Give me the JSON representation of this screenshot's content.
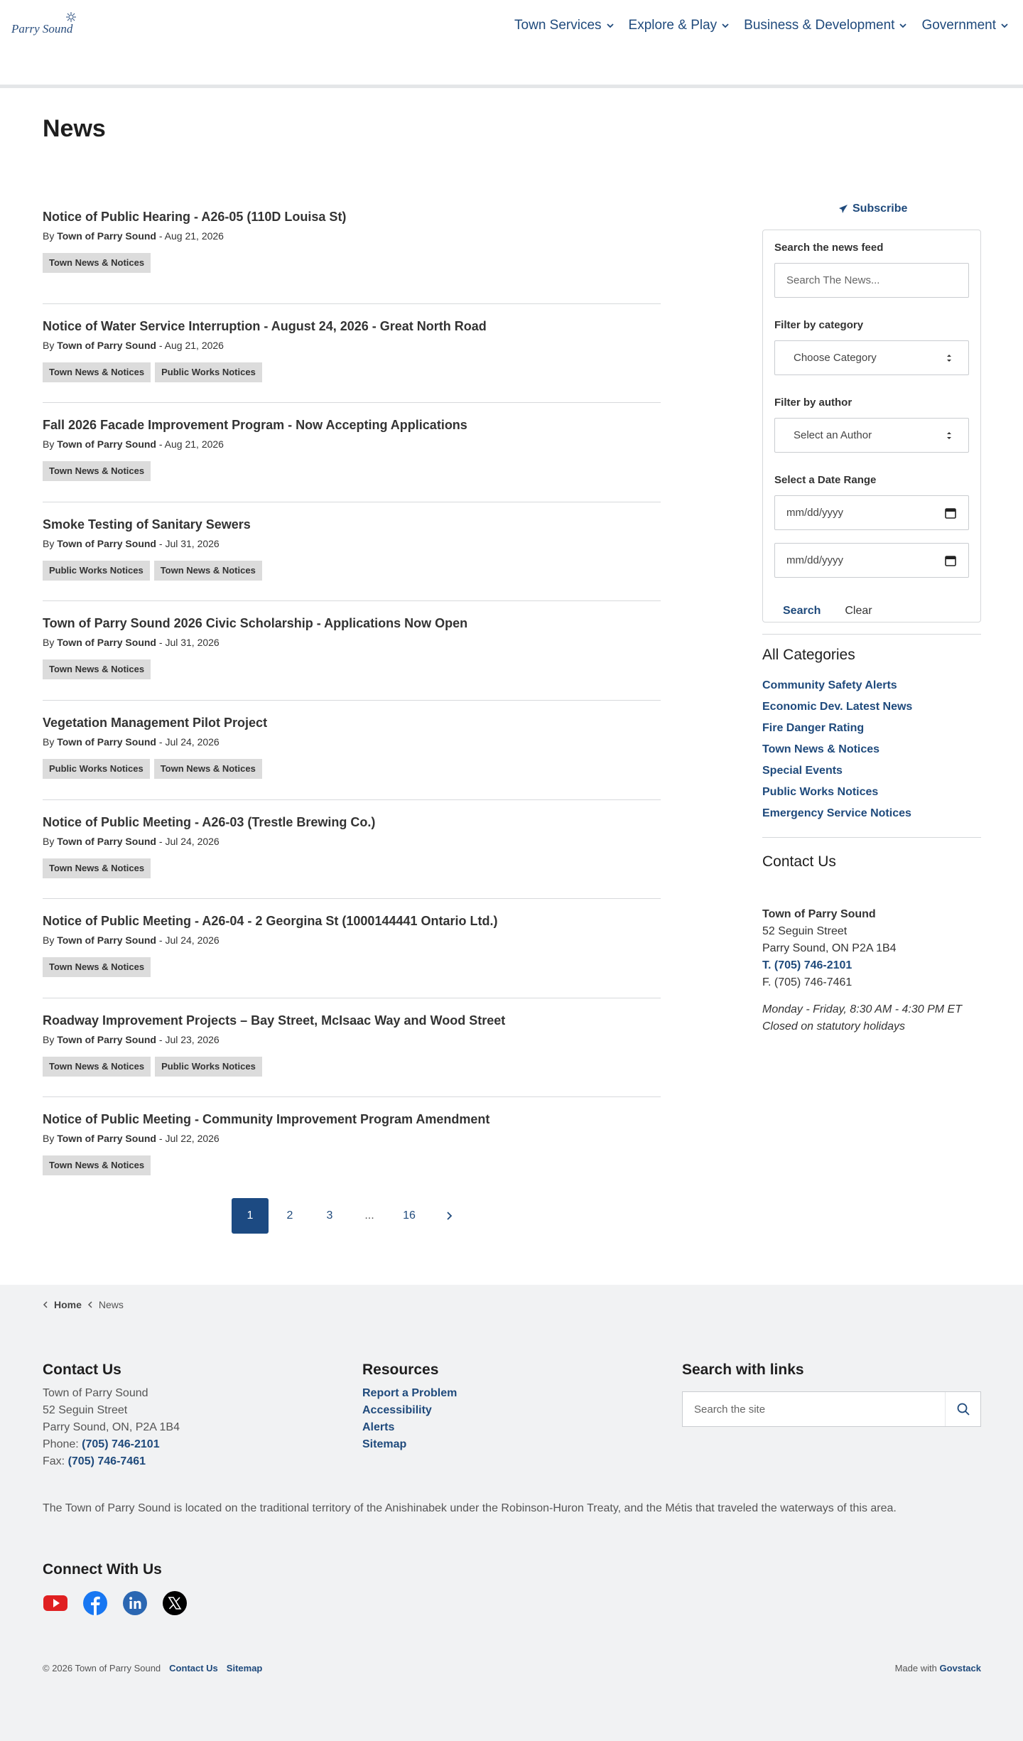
{
  "header": {
    "logo_text": "Parry Sound",
    "nav": [
      {
        "label": "Town Services"
      },
      {
        "label": "Explore & Play"
      },
      {
        "label": "Business & Development"
      },
      {
        "label": "Government"
      }
    ]
  },
  "page": {
    "title": "News"
  },
  "news": [
    {
      "title": "Notice of Public Hearing - A26-05 (110D Louisa St)",
      "by": "By",
      "author": "Town of Parry Sound",
      "sep": "-",
      "date": "Aug 21, 2026",
      "tags": [
        "Town News & Notices"
      ]
    },
    {
      "title": "Notice of Water Service Interruption - August 24, 2026 - Great North Road",
      "by": "By",
      "author": "Town of Parry Sound",
      "sep": "-",
      "date": "Aug 21, 2026",
      "tags": [
        "Town News & Notices",
        "Public Works Notices"
      ]
    },
    {
      "title": "Fall 2026 Facade Improvement Program - Now Accepting Applications",
      "by": "By",
      "author": "Town of Parry Sound",
      "sep": "-",
      "date": "Aug 21, 2026",
      "tags": [
        "Town News & Notices"
      ]
    },
    {
      "title": "Smoke Testing of Sanitary Sewers",
      "by": "By",
      "author": "Town of Parry Sound",
      "sep": "-",
      "date": "Jul 31, 2026",
      "tags": [
        "Public Works Notices",
        "Town News & Notices"
      ]
    },
    {
      "title": "Town of Parry Sound 2026 Civic Scholarship - Applications Now Open",
      "by": "By",
      "author": "Town of Parry Sound",
      "sep": "-",
      "date": "Jul 31, 2026",
      "tags": [
        "Town News & Notices"
      ]
    },
    {
      "title": "Vegetation Management Pilot Project",
      "by": "By",
      "author": "Town of Parry Sound",
      "sep": "-",
      "date": "Jul 24, 2026",
      "tags": [
        "Public Works Notices",
        "Town News & Notices"
      ]
    },
    {
      "title": "Notice of Public Meeting - A26-03 (Trestle Brewing Co.)",
      "by": "By",
      "author": "Town of Parry Sound",
      "sep": "-",
      "date": "Jul 24, 2026",
      "tags": [
        "Town News & Notices"
      ]
    },
    {
      "title": "Notice of Public Meeting - A26-04 - 2 Georgina St (1000144441 Ontario Ltd.)",
      "by": "By",
      "author": "Town of Parry Sound",
      "sep": "-",
      "date": "Jul 24, 2026",
      "tags": [
        "Town News & Notices"
      ]
    },
    {
      "title": "Roadway Improvement Projects – Bay Street, McIsaac Way and Wood Street",
      "by": "By",
      "author": "Town of Parry Sound",
      "sep": "-",
      "date": "Jul 23, 2026",
      "tags": [
        "Town News & Notices",
        "Public Works Notices"
      ]
    },
    {
      "title": "Notice of Public Meeting - Community Improvement Program Amendment",
      "by": "By",
      "author": "Town of Parry Sound",
      "sep": "-",
      "date": "Jul 22, 2026",
      "tags": [
        "Town News & Notices"
      ]
    }
  ],
  "pagination": {
    "pages": [
      "1",
      "2",
      "3",
      "...",
      "16"
    ],
    "current": "1"
  },
  "sidebar": {
    "subscribe_label": "Subscribe",
    "search_label": "Search the news feed",
    "search_placeholder": "Search The News...",
    "category_label": "Filter by category",
    "category_value": "Choose Category",
    "author_label": "Filter by author",
    "author_value": "Select an Author",
    "date_label": "Select a Date Range",
    "date_placeholder_start": "mm/dd/yyyy",
    "date_placeholder_end": "mm/dd/yyyy",
    "search_button": "Search",
    "clear_button": "Clear",
    "categories_heading": "All Categories",
    "categories": [
      "Community Safety Alerts",
      "Economic Dev. Latest News",
      "Fire Danger Rating",
      "Town News & Notices",
      "Special Events",
      "Public Works Notices",
      "Emergency Service Notices"
    ],
    "contact_heading": "Contact Us",
    "contact": {
      "org": "Town of Parry Sound",
      "street": "52 Seguin Street",
      "city": "Parry Sound, ON P2A 1B4",
      "phone": "T. (705) 746-2101",
      "fax": "F. (705) 746-7461",
      "hours": "Monday - Friday, 8:30 AM - 4:30 PM ET",
      "holidays": "Closed on statutory holidays"
    }
  },
  "footer": {
    "breadcrumb": {
      "home": "Home",
      "current": "News"
    },
    "contact_heading": "Contact Us",
    "contact": {
      "org": "Town of Parry Sound",
      "street": "52 Seguin Street",
      "city": "Parry Sound, ON, P2A 1B4",
      "phone_label": "Phone:",
      "phone": "(705) 746-2101",
      "fax_label": "Fax:",
      "fax": "(705) 746-7461"
    },
    "resources_heading": "Resources",
    "resources": [
      "Report a Problem",
      "Accessibility",
      "Alerts",
      "Sitemap"
    ],
    "search_heading": "Search with links",
    "search_placeholder": "Search the site",
    "land_ack": "The Town of Parry Sound is located on the traditional territory of the Anishinabek under the Robinson-Huron Treaty, and the Métis that traveled the waterways of this area.",
    "connect_heading": "Connect With Us",
    "social": [
      "youtube-icon",
      "facebook-icon",
      "linkedin-icon",
      "x-icon"
    ],
    "copyright": "© 2026 Town of Parry Sound",
    "legal_links": [
      "Contact Us",
      "Sitemap"
    ],
    "made_with": "Made with",
    "made_with_brand": "Govstack"
  },
  "colors": {
    "accent": "#1f4a7c",
    "active_page": "#1c4a82",
    "tag_bg": "#dcdcdc",
    "footer_bg": "#f1f2f3"
  }
}
